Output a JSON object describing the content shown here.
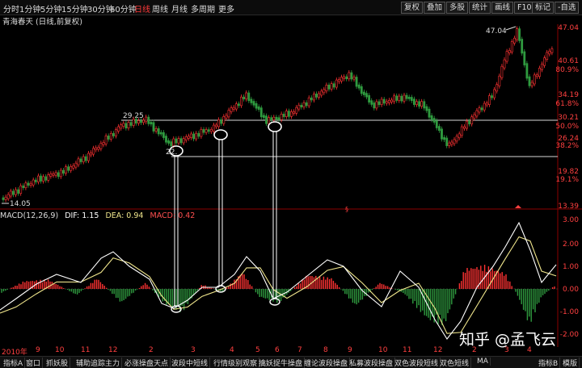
{
  "toolbar": {
    "timeframes": [
      "分时",
      "1分钟",
      "5分钟",
      "15分钟",
      "30分钟",
      "60分钟",
      "日线",
      "周线",
      "月线",
      "多周期",
      "更多"
    ],
    "active": "日线",
    "buttons": [
      "复权",
      "叠加",
      "多股",
      "统计",
      "画线",
      "F10",
      "标记",
      "-自选"
    ]
  },
  "chart": {
    "title": "青海春天 (日线,前复权)",
    "price_labels": [
      "47.04",
      "40.61",
      "34.19",
      "30.21",
      "26.24",
      "19.82",
      "13.39"
    ],
    "pct_labels": [
      "80.9%",
      "61.8%",
      "50.0%",
      "38.2%",
      "19.1%"
    ],
    "annotations": {
      "low": "14.05",
      "level1": "29.25",
      "level2": "22.",
      "high": "47.04"
    }
  },
  "macd": {
    "name": "MACD(12,26,9)",
    "dif_label": "DIF: 1.15",
    "dea_label": "DEA: 0.94",
    "macd_label": "MACD: 0.42",
    "scale": [
      "3.00",
      "2.00",
      "1.00",
      "0.00",
      "-1.00",
      "-2.00"
    ]
  },
  "time_axis": {
    "year": "2010年",
    "months": [
      "9",
      "10",
      "11",
      "12",
      "2",
      "3",
      "4",
      "5",
      "6",
      "7",
      "8",
      "9",
      "10",
      "11",
      "12",
      "2",
      "3",
      "4"
    ]
  },
  "bottom_tabs": [
    "指标A",
    "窗口",
    "抓妖股",
    "辅助追踪主力",
    "必涨操盘天点",
    "波段中短线",
    "行情级别观察",
    "擒妖捉牛操盘",
    "缠论波段操盘",
    "私募波段操盘",
    "双色波段短线",
    "双色短线",
    "MA"
  ],
  "bottom_right": [
    "指标B",
    "模版"
  ],
  "watermark": "知乎 @孟飞云",
  "colors": {
    "up": "#ff3232",
    "down": "#2f9a3f",
    "dif": "#ffffff",
    "dea": "#f0e68c",
    "axis": "#ff4040"
  }
}
